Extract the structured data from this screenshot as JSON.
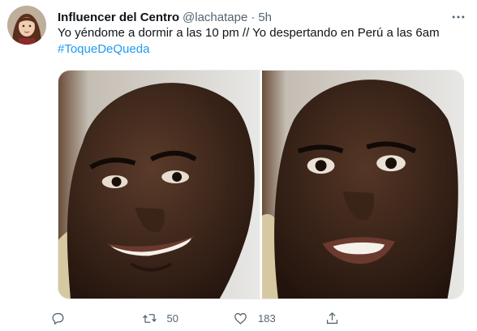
{
  "tweet": {
    "display_name": "Influencer del Centro",
    "handle": "@lachatape",
    "separator": "·",
    "time": "5h",
    "text": "Yo yéndome a dormir a las 10 pm // Yo despertando en Perú a las 6am",
    "hashtag": "#ToqueDeQueda",
    "media": [
      {
        "description": "smiling-man-photo"
      },
      {
        "description": "worried-man-photo"
      }
    ]
  },
  "actions": {
    "reply_count": "",
    "retweet_count": "50",
    "like_count": "183",
    "share_count": ""
  },
  "colors": {
    "accent": "#1d9bf0",
    "secondary_text": "#536471",
    "primary_text": "#0f1419"
  },
  "icons": [
    "avatar",
    "more-icon",
    "reply-icon",
    "retweet-icon",
    "like-icon",
    "share-icon"
  ]
}
